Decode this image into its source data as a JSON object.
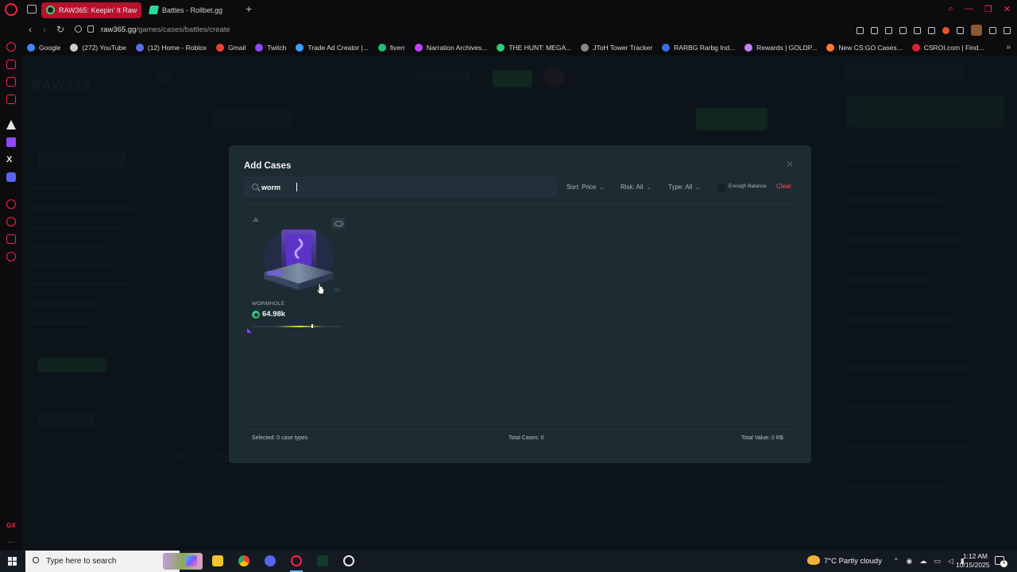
{
  "browser": {
    "tabs": [
      {
        "label": "RAW365: Keepin' It Raw",
        "active": true
      },
      {
        "label": "Battles - Rollbet.gg",
        "active": false
      }
    ],
    "url_host": "raw365.gg",
    "url_path": "/games/cases/battles/create",
    "bookmarks": [
      {
        "label": "Google",
        "icon_color": "#4285f4"
      },
      {
        "label": "(272) YouTube",
        "icon_color": "#cccccc"
      },
      {
        "label": "(12) Home - Roblox",
        "icon_color": "#5b6ee8"
      },
      {
        "label": "Gmail",
        "icon_color": "#ea4335"
      },
      {
        "label": "Twitch",
        "icon_color": "#9146ff"
      },
      {
        "label": "Trade Ad Creator |...",
        "icon_color": "#3aa0ff"
      },
      {
        "label": "fiverr",
        "icon_color": "#1dbf73"
      },
      {
        "label": "Narration Archives...",
        "icon_color": "#c040ff"
      },
      {
        "label": "THE HUNT: MEGA...",
        "icon_color": "#2ecc71"
      },
      {
        "label": "JToH Tower Tracker",
        "icon_color": "#888888"
      },
      {
        "label": "RARBG Rarbg Ind...",
        "icon_color": "#3a6ee8"
      },
      {
        "label": "Rewards | GOLDP...",
        "icon_color": "#c080ff"
      },
      {
        "label": "New CS:GO Cases...",
        "icon_color": "#ff7a2a"
      },
      {
        "label": "CSROI.com | Find...",
        "icon_color": "#e02030"
      }
    ]
  },
  "modal": {
    "title": "Add Cases",
    "search_value": "worm",
    "filters": {
      "sort_label": "Sort: Price",
      "risk_label": "Risk: All",
      "type_label": "Type: All",
      "enough_balance_label": "Enough Balance",
      "enough_balance_checked": false,
      "clear_label": "Clear"
    },
    "cases": [
      {
        "name": "WORMHOLE",
        "price": "64.98k",
        "percent": "10%",
        "accent_color": "#8b3cff"
      }
    ],
    "footer": {
      "selected": "Selected: 0 case types",
      "total_cases": "Total Cases: 0",
      "total_value": "Total Value: 0 R$"
    }
  },
  "taskbar": {
    "search_placeholder": "Type here to search",
    "weather": "7°C  Partly cloudy",
    "time": "1:12 AM",
    "date": "10/15/2025",
    "notifications": "5"
  }
}
